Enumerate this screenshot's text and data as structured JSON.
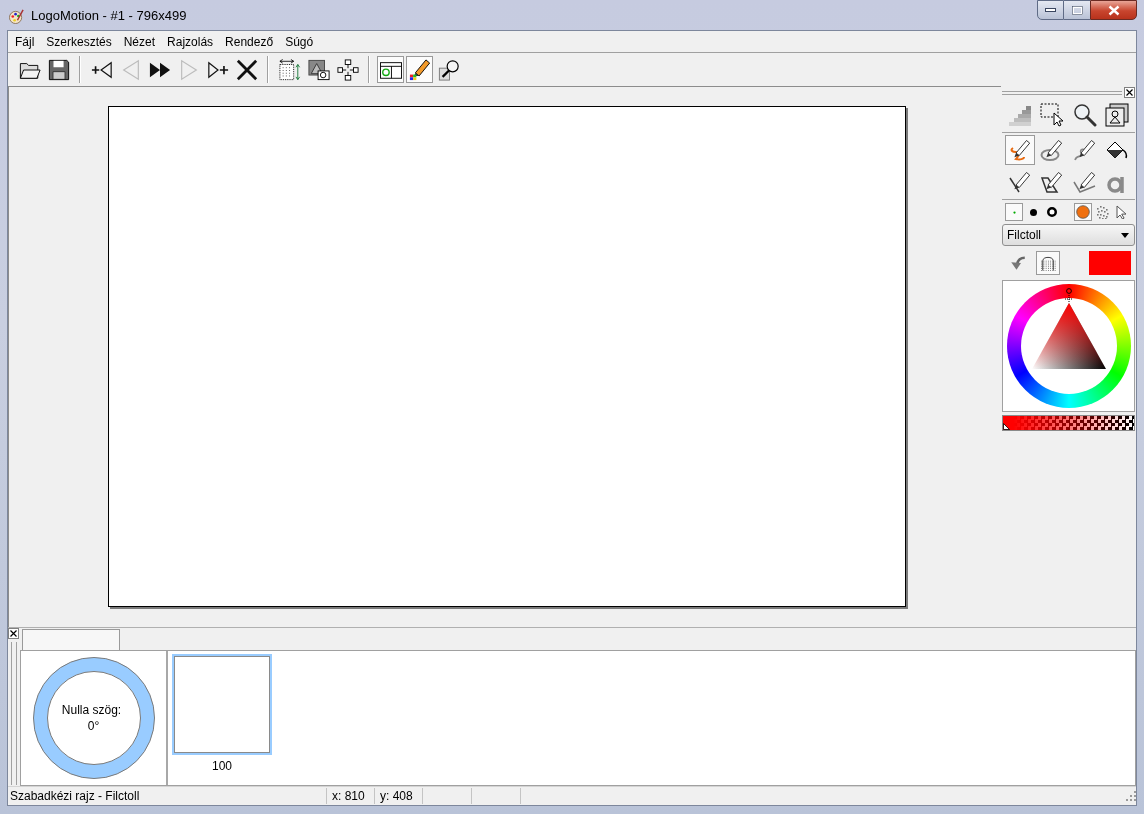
{
  "window": {
    "title": "LogoMotion - #1 - 796x499"
  },
  "menu": [
    {
      "label": "Fájl"
    },
    {
      "label": "Szerkesztés"
    },
    {
      "label": "Nézet"
    },
    {
      "label": "Rajzolás"
    },
    {
      "label": "Rendező"
    },
    {
      "label": "Súgó"
    }
  ],
  "toolbar": [
    {
      "kind": "button",
      "pressed": false,
      "disabled": false
    },
    {
      "kind": "button",
      "pressed": false,
      "disabled": false
    },
    {
      "kind": "separator"
    },
    {
      "kind": "button",
      "pressed": false,
      "disabled": false
    },
    {
      "kind": "button",
      "pressed": false,
      "disabled": true
    },
    {
      "kind": "button",
      "pressed": false,
      "disabled": false
    },
    {
      "kind": "button",
      "pressed": false,
      "disabled": true
    },
    {
      "kind": "button",
      "pressed": false,
      "disabled": false
    },
    {
      "kind": "button",
      "pressed": false,
      "disabled": false
    },
    {
      "kind": "separator"
    },
    {
      "kind": "button",
      "pressed": false,
      "disabled": false
    },
    {
      "kind": "button",
      "pressed": false,
      "disabled": false
    },
    {
      "kind": "button",
      "pressed": false,
      "disabled": false
    },
    {
      "kind": "separator"
    },
    {
      "kind": "button",
      "pressed": true,
      "disabled": false
    },
    {
      "kind": "button",
      "pressed": true,
      "disabled": false
    },
    {
      "kind": "button",
      "pressed": false,
      "disabled": false
    }
  ],
  "tool_palette": {
    "tool_groups": [
      {
        "tools": [
          {
            "selected": false
          },
          {
            "selected": false
          },
          {
            "selected": false
          },
          {
            "selected": false
          }
        ]
      },
      {
        "tools": [
          {
            "selected": true
          },
          {
            "selected": false
          },
          {
            "selected": false
          },
          {
            "selected": false
          },
          {
            "selected": false
          },
          {
            "selected": false
          },
          {
            "selected": false
          },
          {
            "selected": false
          }
        ]
      }
    ],
    "brush_sizes": [
      {
        "selected": true
      },
      {
        "selected": false
      },
      {
        "selected": false
      }
    ],
    "brush_modes": [
      {
        "selected": true
      },
      {
        "selected": false
      },
      {
        "selected": false
      }
    ],
    "brush_type": {
      "value": "Filctoll"
    },
    "color_tools": [
      {
        "pressed": false
      },
      {
        "pressed": true
      }
    ],
    "current_color": {
      "color": "#ff0000"
    },
    "alpha_slider": {
      "level": 0
    }
  },
  "bottom_panel": {
    "angle_dial": {
      "label": "Nulla szög:",
      "value": "0°"
    },
    "frames": [
      {
        "label": "100",
        "selected": true
      }
    ]
  },
  "status_bar": {
    "message": "Szabadkézi rajz - Filctoll",
    "panes": [
      "x: 810",
      "y: 408"
    ]
  }
}
